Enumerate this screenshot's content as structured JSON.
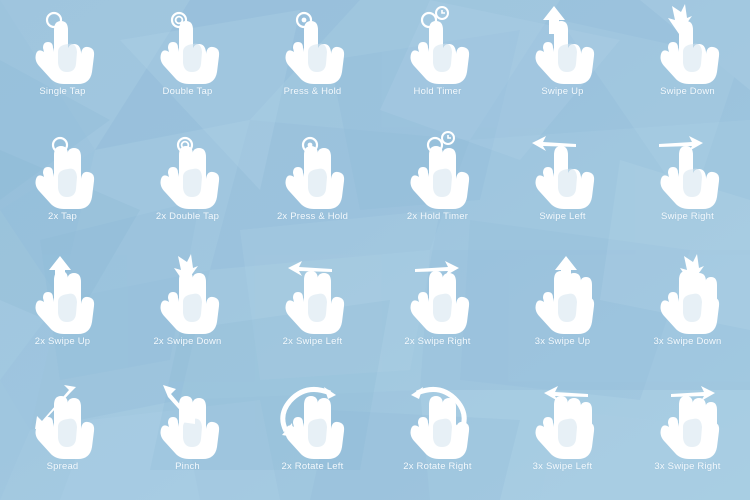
{
  "page": {
    "title": "Touch Gestures Icon Sheet",
    "background_color_top_left": "#9cc3de",
    "background_color_bottom_right": "#a6cce3",
    "label_color": "#f4fafe",
    "icon_color": "#ffffff",
    "icon_shade_color": "#d3e3ef",
    "columns": 6,
    "rows": 4
  },
  "gestures": [
    {
      "label": "Single Tap",
      "icon": "hand-one-finger-tap-icon",
      "fingers": 1,
      "marker": "ring"
    },
    {
      "label": "Double Tap",
      "icon": "hand-one-finger-double-tap-icon",
      "fingers": 1,
      "marker": "double-ring"
    },
    {
      "label": "Press & Hold",
      "icon": "hand-one-finger-press-hold-icon",
      "fingers": 1,
      "marker": "ring-dot"
    },
    {
      "label": "Hold Timer",
      "icon": "hand-one-finger-hold-timer-icon",
      "fingers": 1,
      "marker": "ring-clock"
    },
    {
      "label": "Swipe Up",
      "icon": "hand-one-finger-swipe-up-icon",
      "fingers": 1,
      "marker": "arrow-up"
    },
    {
      "label": "Swipe Down",
      "icon": "hand-one-finger-swipe-down-icon",
      "fingers": 1,
      "marker": "arrow-down"
    },
    {
      "label": "2x Tap",
      "icon": "hand-two-finger-tap-icon",
      "fingers": 2,
      "marker": "ring"
    },
    {
      "label": "2x Double Tap",
      "icon": "hand-two-finger-double-tap-icon",
      "fingers": 2,
      "marker": "double-ring"
    },
    {
      "label": "2x Press & Hold",
      "icon": "hand-two-finger-press-hold-icon",
      "fingers": 2,
      "marker": "ring-dot"
    },
    {
      "label": "2x Hold Timer",
      "icon": "hand-two-finger-hold-timer-icon",
      "fingers": 2,
      "marker": "ring-clock"
    },
    {
      "label": "Swipe Left",
      "icon": "hand-one-finger-swipe-left-icon",
      "fingers": 1,
      "marker": "arrow-left"
    },
    {
      "label": "Swipe Right",
      "icon": "hand-one-finger-swipe-right-icon",
      "fingers": 1,
      "marker": "arrow-right"
    },
    {
      "label": "2x Swipe Up",
      "icon": "hand-two-finger-swipe-up-icon",
      "fingers": 2,
      "marker": "arrow-up"
    },
    {
      "label": "2x Swipe Down",
      "icon": "hand-two-finger-swipe-down-icon",
      "fingers": 2,
      "marker": "arrow-down"
    },
    {
      "label": "2x Swipe Left",
      "icon": "hand-two-finger-swipe-left-icon",
      "fingers": 2,
      "marker": "arrow-left"
    },
    {
      "label": "2x Swipe Right",
      "icon": "hand-two-finger-swipe-right-icon",
      "fingers": 2,
      "marker": "arrow-right"
    },
    {
      "label": "3x Swipe Up",
      "icon": "hand-three-finger-swipe-up-icon",
      "fingers": 3,
      "marker": "arrow-up"
    },
    {
      "label": "3x Swipe Down",
      "icon": "hand-three-finger-swipe-down-icon",
      "fingers": 3,
      "marker": "arrow-down"
    },
    {
      "label": "Spread",
      "icon": "hand-spread-icon",
      "fingers": 2,
      "marker": "arrows-diagonal-out"
    },
    {
      "label": "Pinch",
      "icon": "hand-pinch-icon",
      "fingers": 2,
      "marker": "arrows-diagonal-in"
    },
    {
      "label": "2x Rotate Left",
      "icon": "hand-two-finger-rotate-left-icon",
      "fingers": 2,
      "marker": "arc-arrow-left"
    },
    {
      "label": "2x Rotate Right",
      "icon": "hand-two-finger-rotate-right-icon",
      "fingers": 2,
      "marker": "arc-arrow-right"
    },
    {
      "label": "3x Swipe Left",
      "icon": "hand-three-finger-swipe-left-icon",
      "fingers": 3,
      "marker": "arrow-left"
    },
    {
      "label": "3x Swipe Right",
      "icon": "hand-three-finger-swipe-right-icon",
      "fingers": 3,
      "marker": "arrow-right"
    }
  ]
}
